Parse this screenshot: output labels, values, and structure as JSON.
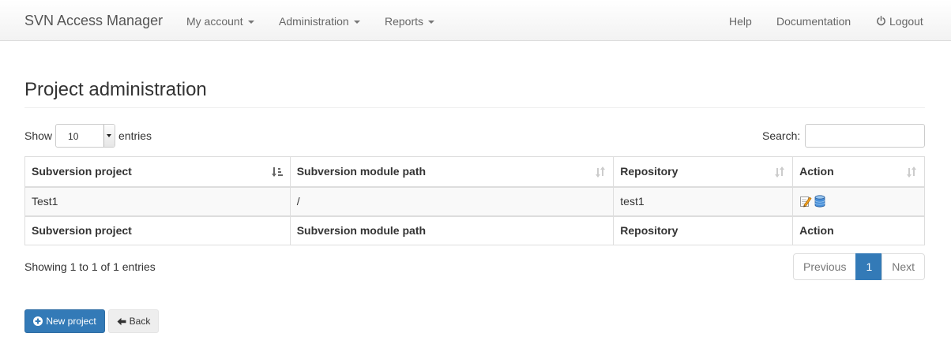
{
  "navbar": {
    "brand": "SVN Access Manager",
    "menus": [
      {
        "label": "My account"
      },
      {
        "label": "Administration"
      },
      {
        "label": "Reports"
      }
    ],
    "help": "Help",
    "documentation": "Documentation",
    "logout": "Logout"
  },
  "page": {
    "title": "Project administration"
  },
  "table_controls": {
    "show_label": "Show",
    "entries_label": "entries",
    "length_value": "10",
    "search_label": "Search:",
    "search_value": ""
  },
  "table": {
    "headers": [
      "Subversion project",
      "Subversion module path",
      "Repository",
      "Action"
    ],
    "rows": [
      {
        "project": "Test1",
        "path": "/",
        "repository": "test1",
        "actions": [
          "edit-icon",
          "database-icon"
        ]
      }
    ],
    "footers": [
      "Subversion project",
      "Subversion module path",
      "Repository",
      "Action"
    ]
  },
  "info": "Showing 1 to 1 of 1 entries",
  "pagination": {
    "previous": "Previous",
    "current": "1",
    "next": "Next"
  },
  "buttons": {
    "new_project": "New project",
    "back": "Back"
  },
  "colors": {
    "primary": "#337ab7",
    "navbar_bg": "#f8f8f8"
  }
}
